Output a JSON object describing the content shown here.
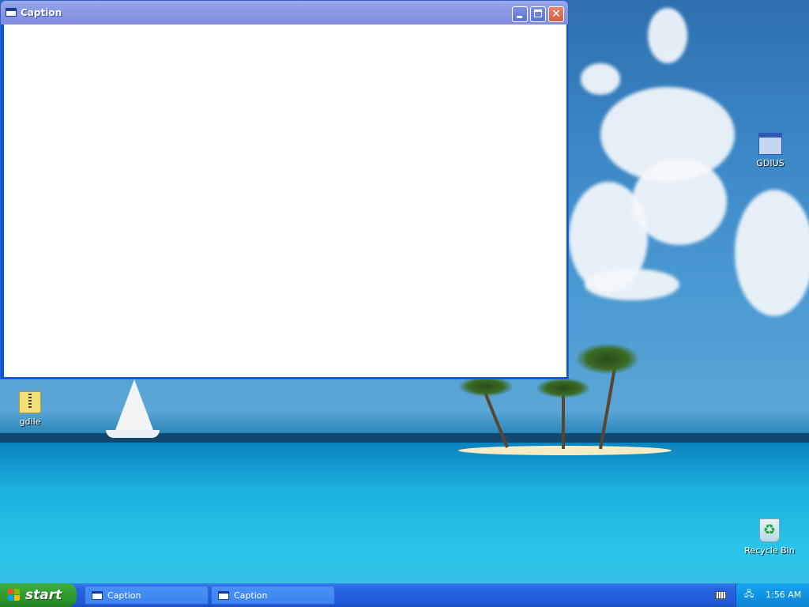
{
  "window": {
    "title": "Caption",
    "buttons": {
      "minimize_icon": "minimize-icon",
      "maximize_icon": "maximize-icon",
      "close_glyph": "✕"
    }
  },
  "desktop_icons": [
    {
      "label": "GDIUS",
      "icon": "application-window-icon"
    },
    {
      "label": "gdile",
      "icon": "zip-folder-icon"
    },
    {
      "label": "Recycle Bin",
      "icon": "recycle-bin-icon"
    }
  ],
  "taskbar": {
    "start_label": "start",
    "tasks": [
      {
        "label": "Caption"
      },
      {
        "label": "Caption"
      }
    ],
    "tray": {
      "clock": "1:56 AM"
    }
  },
  "colors": {
    "start_green": "#36a336",
    "taskbar_blue": "#245edb",
    "title_bar": "#8c9ae4",
    "tray_blue": "#0f93e3"
  }
}
